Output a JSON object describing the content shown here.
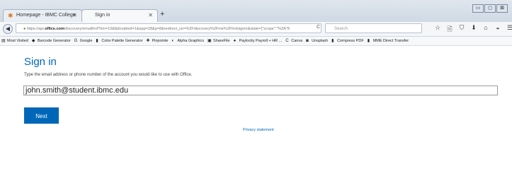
{
  "browser": {
    "tabs": [
      {
        "label": "Homepage - IBMC College",
        "icon": "ibmc-icon"
      },
      {
        "label": "Sign in",
        "icon": "blank-page-icon"
      }
    ],
    "new_tab": "+",
    "window_controls": [
      "▭",
      "◻",
      "⊠"
    ],
    "url_prefix": "https://api.",
    "url_domain": "office.com",
    "url_rest": "/discovery/emailhrd?hm=10&fpEnabled=1&app=28&p=8&redirect_uri=%2Fdiscovery%2Fme%2Fhrdsignin&state={\"scope\":\"%3A\"8",
    "search_placeholder": "Search",
    "back": "◀",
    "reload": "C",
    "toolbar_icons": [
      "☆",
      "🗎",
      "⛉",
      "⬇",
      "⌂",
      "◒",
      "☰"
    ]
  },
  "bookmarks": [
    {
      "label": "Most Visited",
      "icon": "▤"
    },
    {
      "label": "Barcode Generator",
      "icon": "◆"
    },
    {
      "label": "Google",
      "icon": "G"
    },
    {
      "label": "Color Palette Generator",
      "icon": "▮"
    },
    {
      "label": "Pinpointe",
      "icon": "✚"
    },
    {
      "label": "Alpha Graphics",
      "icon": "◐"
    },
    {
      "label": "ShareFile",
      "icon": "▣"
    },
    {
      "label": "Paylocity Payroll + HR ...",
      "icon": "●"
    },
    {
      "label": "Canva",
      "icon": "C"
    },
    {
      "label": "Unsplash",
      "icon": "◙"
    },
    {
      "label": "Compress PDF",
      "icon": "▮"
    },
    {
      "label": "MME Direct Transfer",
      "icon": "▮"
    }
  ],
  "signin": {
    "title": "Sign in",
    "description": "Type the email address or phone number of the account you would like to use with Office.",
    "email_value": "john.smith@student.ibmc.edu",
    "next_label": "Next",
    "privacy_label": "Privacy statement"
  },
  "colors": {
    "accent": "#0067b8"
  }
}
